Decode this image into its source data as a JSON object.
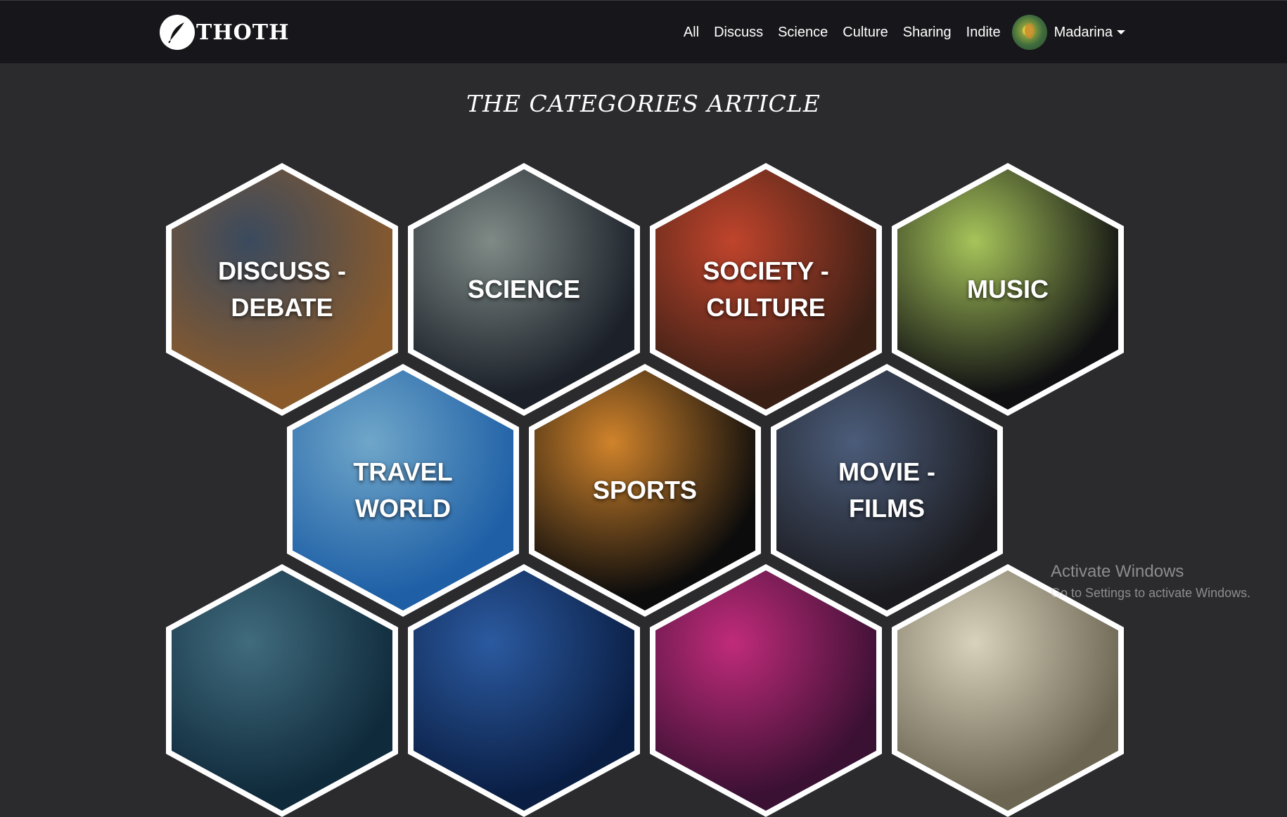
{
  "brand": {
    "name": "THOTH",
    "logo_icon": "feather-quill-icon"
  },
  "nav": {
    "links": [
      "All",
      "Discuss",
      "Science",
      "Culture",
      "Sharing",
      "Indite"
    ],
    "user_name": "Madarina",
    "avatar_icon": "user-avatar"
  },
  "page": {
    "title": "THE CATEGORIES ARTICLE"
  },
  "categories": [
    {
      "label": "DISCUSS - DEBATE",
      "image": "meeting-table-photo",
      "colors": [
        "#8a5a2b",
        "#3a4a5e"
      ]
    },
    {
      "label": "SCIENCE",
      "image": "dna-helix-photo",
      "colors": [
        "#1b2029",
        "#7f8a86"
      ]
    },
    {
      "label": "SOCIETY - CULTURE",
      "image": "lanterns-photo",
      "colors": [
        "#3a1f15",
        "#c0442c"
      ]
    },
    {
      "label": "MUSIC",
      "image": "vinyl-record-photo",
      "colors": [
        "#101012",
        "#a6c45a"
      ]
    },
    {
      "label": "TRAVEL WORLD",
      "image": "world-landmarks-photo",
      "colors": [
        "#1e5fa6",
        "#6fa6c9"
      ]
    },
    {
      "label": "SPORTS",
      "image": "sports-balls-photo",
      "colors": [
        "#0c0c0c",
        "#d0832b"
      ]
    },
    {
      "label": "MOVIE - FILMS",
      "image": "movie-posters-photo",
      "colors": [
        "#1b1b1f",
        "#4b5c7a"
      ]
    },
    {
      "label": "",
      "image": "city-night-photo",
      "colors": [
        "#0f2a3b",
        "#406c7e"
      ]
    },
    {
      "label": "",
      "image": "stock-market-photo",
      "colors": [
        "#0a1e44",
        "#2b5aa0"
      ]
    },
    {
      "label": "",
      "image": "neon-pink-photo",
      "colors": [
        "#3a1033",
        "#c02b7a"
      ]
    },
    {
      "label": "",
      "image": "letters-photo",
      "colors": [
        "#6b6552",
        "#d8d1bb"
      ]
    }
  ],
  "os_overlay": {
    "line1": "Activate Windows",
    "line2": "Go to Settings to activate Windows."
  }
}
